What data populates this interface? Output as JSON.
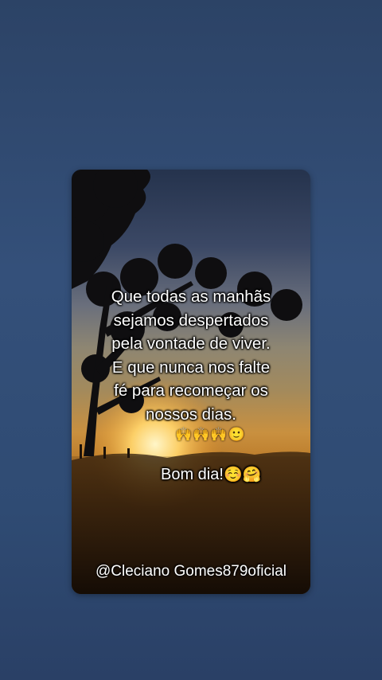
{
  "post": {
    "quote_lines": [
      "Que todas as manhãs",
      "sejamos despertados",
      "pela vontade de viver.",
      "E que nunca nos falte",
      "fé para recomeçar os",
      "nossos dias."
    ],
    "hands_emoji": "🙌🙌🙌",
    "smile_emoji": "🙂",
    "greeting": "Bom dia!",
    "greeting_emoji": "☺️🤗",
    "handle": "@Cleciano Gomes879oficial"
  }
}
